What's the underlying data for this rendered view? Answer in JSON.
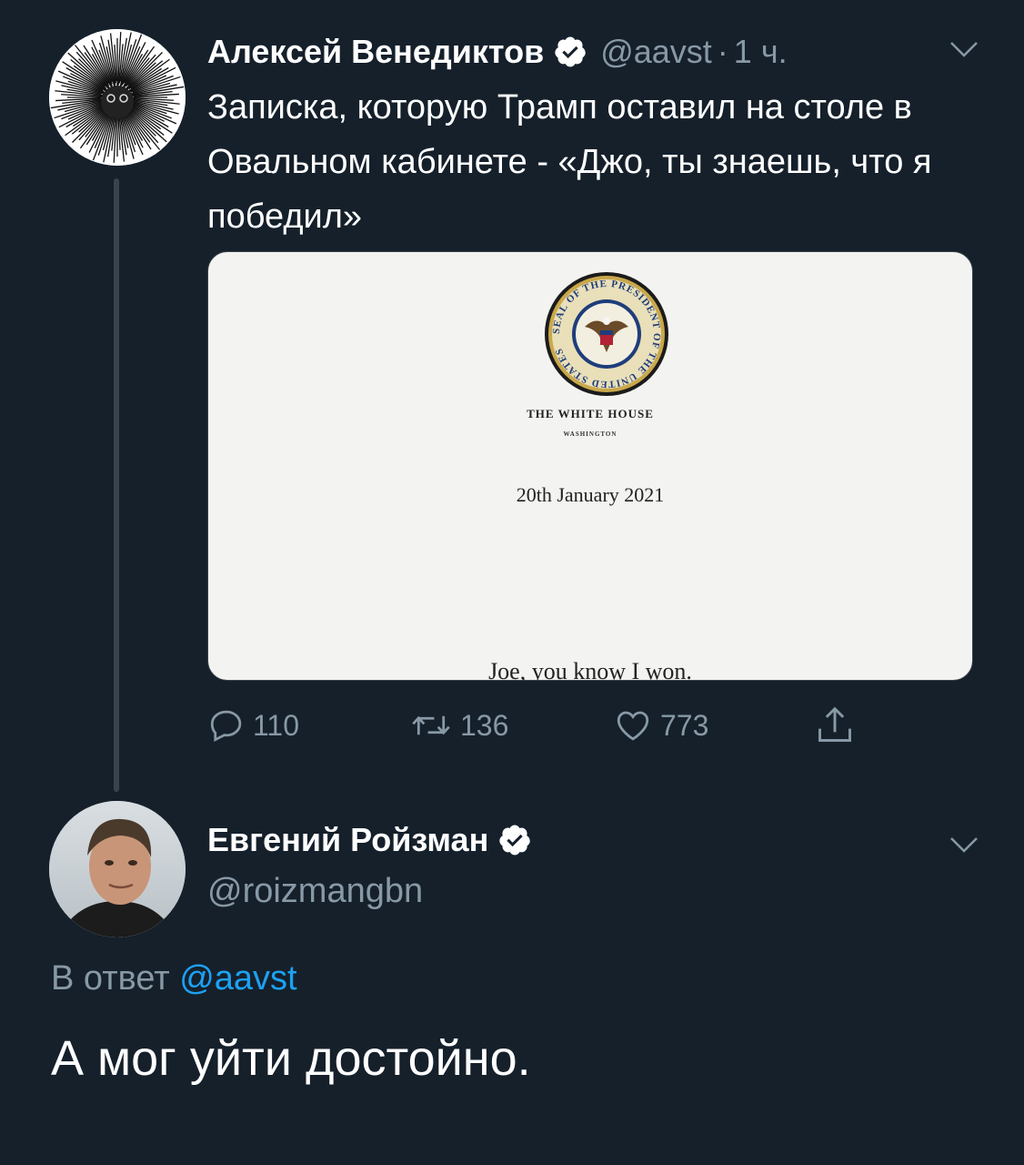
{
  "tweet1": {
    "author_name": "Алексей Венедиктов",
    "handle": "@aavst",
    "separator": "·",
    "time": "1 ч.",
    "text": "Записка, которую Трамп оставил на столе в Овальном кабинете - «Джо, ты знаешь, что я победил»",
    "media": {
      "seal_text": "SEAL OF THE PRESIDENT OF THE UNITED STATES",
      "title": "THE WHITE HOUSE",
      "subtitle": "WASHINGTON",
      "date": "20th January 2021",
      "note": "Joe, you know I won."
    },
    "actions": {
      "replies": "110",
      "retweets": "136",
      "likes": "773"
    }
  },
  "tweet2": {
    "author_name": "Евгений Ройзман",
    "handle": "@roizmangbn",
    "reply_prefix": "В ответ",
    "reply_mention": "@aavst",
    "text": "А мог уйти достойно."
  },
  "colors": {
    "background": "#15202b",
    "text_primary": "#ffffff",
    "text_secondary": "#8899a6",
    "accent": "#1da1f2",
    "divider": "#38444d"
  },
  "icons": [
    "verified-badge-icon",
    "chevron-down-icon",
    "reply-icon",
    "retweet-icon",
    "like-icon",
    "share-icon"
  ]
}
